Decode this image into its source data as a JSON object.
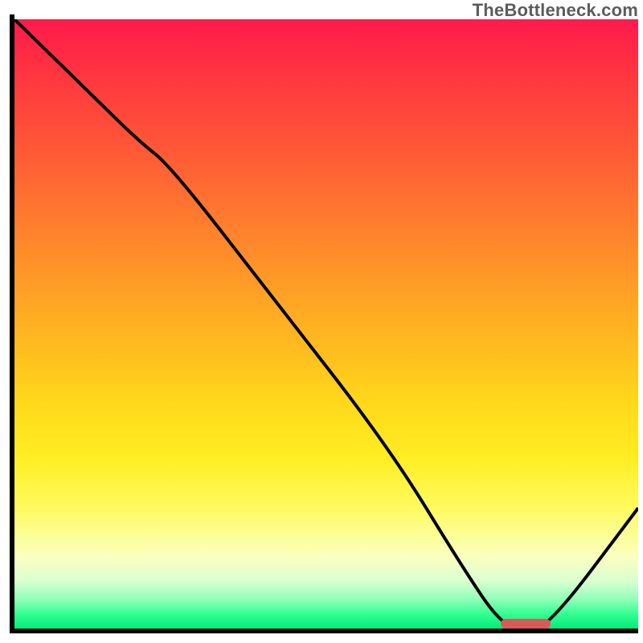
{
  "watermark": {
    "text": "TheBottleneck.com"
  },
  "chart_data": {
    "type": "line",
    "title": "",
    "xlabel": "",
    "ylabel": "",
    "xlim": [
      0,
      100
    ],
    "ylim": [
      0,
      100
    ],
    "x": [
      0,
      5,
      12,
      20,
      25,
      41,
      60,
      72,
      78,
      82,
      86,
      100
    ],
    "values": [
      100,
      95,
      88,
      80,
      76,
      55,
      30,
      10,
      1,
      0,
      1,
      20
    ],
    "optimal_zone": {
      "x_start": 78,
      "x_end": 86,
      "y": 1
    },
    "background_gradient": {
      "stops": [
        {
          "pos": 0.0,
          "color": "#ff1a4b"
        },
        {
          "pos": 0.5,
          "color": "#ffc020"
        },
        {
          "pos": 0.8,
          "color": "#fffb60"
        },
        {
          "pos": 1.0,
          "color": "#00e877"
        }
      ],
      "meaning": "red=worst, green=best (lower y is better)"
    }
  },
  "colors": {
    "curve": "#000000",
    "marker": "#d75a5a",
    "axis": "#000000",
    "watermark": "#5c5c5c"
  }
}
